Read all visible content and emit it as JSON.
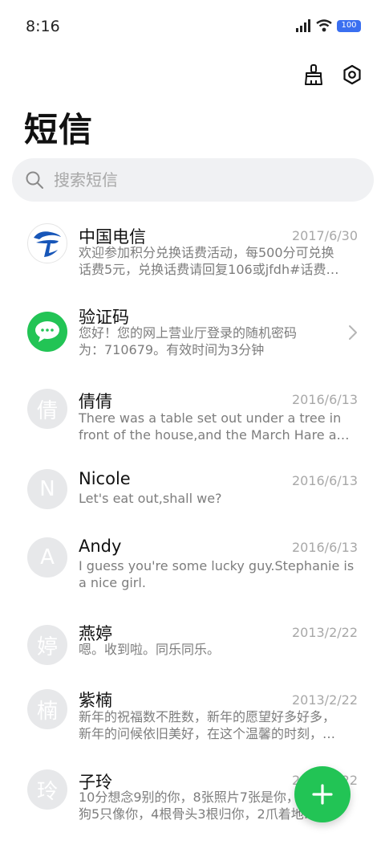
{
  "status_bar": {
    "time": "8:16",
    "battery": "100",
    "icons": [
      "signal-icon",
      "wifi-icon",
      "battery-icon"
    ]
  },
  "header": {
    "title": "短信",
    "actions": [
      "broom-icon",
      "settings-icon"
    ]
  },
  "search": {
    "placeholder": "搜索短信"
  },
  "colors": {
    "accent": "#22c455",
    "battery": "#3a6ff0",
    "avatar_gray": "#e7e8ea"
  },
  "conversations": [
    {
      "name": "中国电信",
      "date": "2017/6/30",
      "line1": "欢迎参加积分兑换话费活动，每500分可兑换",
      "line2": "话费5元，兑换话费请回复106或jfdh#话费…",
      "avatar_type": "telecom-logo"
    },
    {
      "name": "验证码",
      "date": "",
      "line1": "您好！您的网上营业厅登录的随机密码",
      "line2": "为：710679。有效时间为3分钟",
      "avatar_type": "chat-bubble-icon"
    },
    {
      "name": "倩倩",
      "date": "2016/6/13",
      "line1": "There was a table set out under a tree in",
      "line2": "front of the house,and the March Hare a…",
      "avatar_letter": "倩"
    },
    {
      "name": "Nicole",
      "date": "2016/6/13",
      "line1": "Let's eat out,shall we?",
      "line2": "",
      "avatar_letter": "N"
    },
    {
      "name": "Andy",
      "date": "2016/6/13",
      "line1": "I guess you're some lucky guy.Stephanie is",
      "line2": "a nice girl.",
      "avatar_letter": "A"
    },
    {
      "name": "燕婷",
      "date": "2013/2/22",
      "line1": "嗯。收到啦。同乐同乐。",
      "line2": "",
      "avatar_letter": "婷"
    },
    {
      "name": "紫楠",
      "date": "2013/2/22",
      "line1": "新年的祝福数不胜数，新年的愿望好多好多，",
      "line2": "新年的问候依旧美好，在这个温馨的时刻，…",
      "avatar_letter": "楠"
    },
    {
      "name": "子玲",
      "date": "2013/2/22",
      "line1": "10分想念9别的你，8张照片7张是你，6条",
      "line2": "狗5只像你，4根骨头3根归你，2爪着地…",
      "avatar_letter": "玲"
    }
  ],
  "fab": {
    "icon": "plus-icon"
  }
}
